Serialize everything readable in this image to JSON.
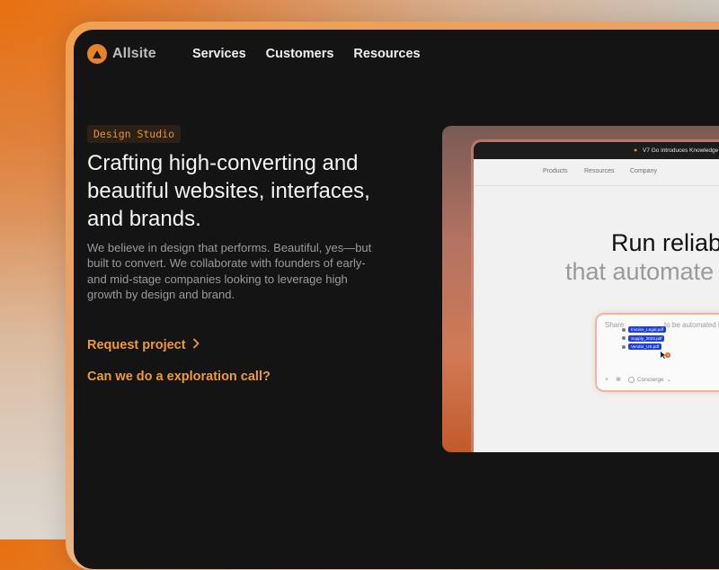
{
  "brand": {
    "name": "Allsite",
    "accent": "#e8832a"
  },
  "nav": {
    "items": [
      {
        "label": "Services"
      },
      {
        "label": "Customers"
      },
      {
        "label": "Resources"
      }
    ]
  },
  "hero": {
    "badge": "Design Studio",
    "headline": "Crafting high-converting and beautiful websites, interfaces, and brands.",
    "description": "We believe in design that performs. Beautiful, yes—but built to convert. We collaborate with founders of early- and mid-stage companies looking to leverage high growth by design and brand.",
    "cta_primary": "Request project",
    "cta_secondary": "Can we do a exploration call?"
  },
  "preview": {
    "announcement": "V7 Go introduces Knowledge",
    "nav": [
      {
        "label": "Products"
      },
      {
        "label": "Resources"
      },
      {
        "label": "Company"
      }
    ],
    "headline_line1": "Run reliab",
    "headline_line2": "that automate",
    "chat": {
      "prompt_start": "Share",
      "prompt_end": "to be automated b",
      "files": [
        "Invoice_Legal.pdf",
        "Supply_2023.pdf",
        "Vendor_US.pdf"
      ],
      "badge_count": "3",
      "tool_add": "+",
      "tool_attach": "⊕",
      "concierge_label": "Concierge"
    }
  }
}
